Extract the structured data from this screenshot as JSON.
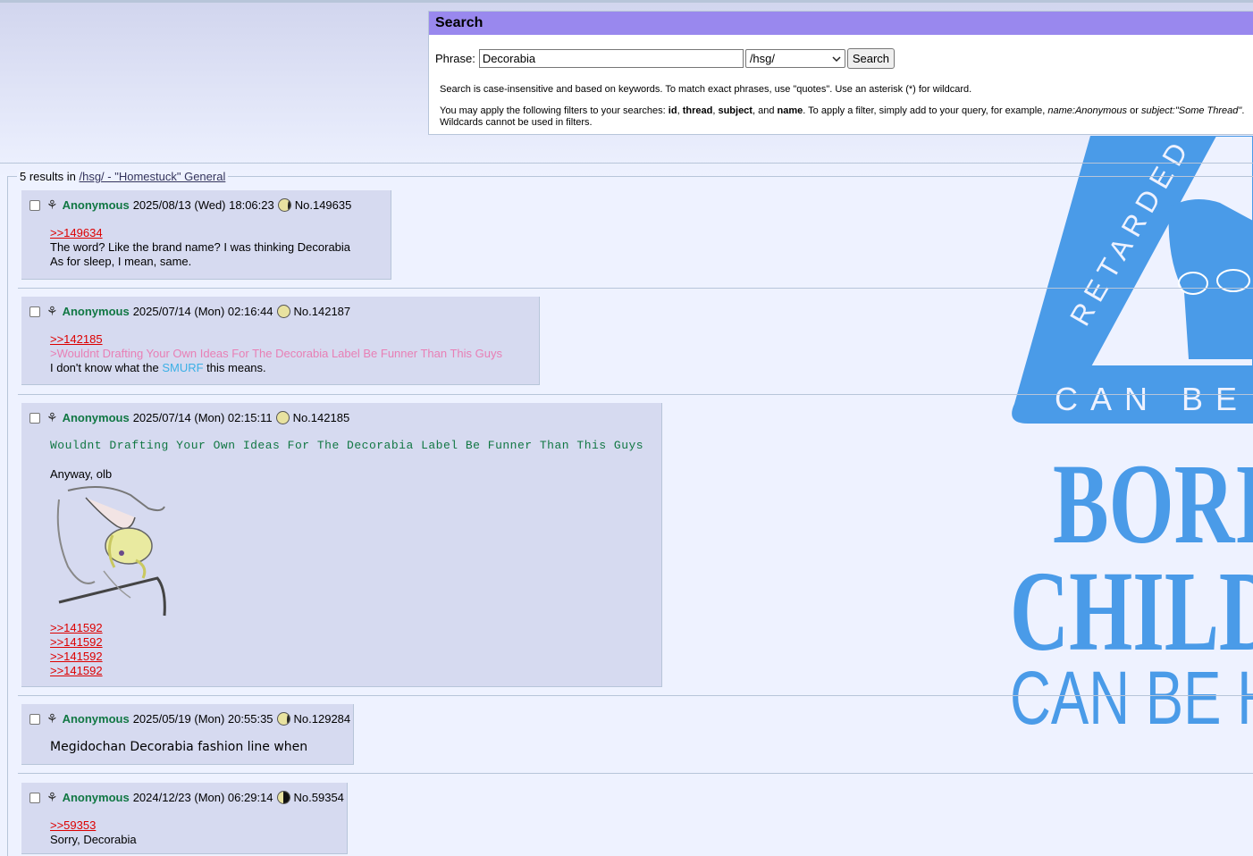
{
  "search": {
    "title": "Search",
    "phrase_label": "Phrase:",
    "phrase_value": "Decorabia",
    "board_selected": "/hsg/",
    "button_label": "Search",
    "help_1": "Search is case-insensitive and based on keywords. To match exact phrases, use \"quotes\". Use an asterisk (*) for wildcard.",
    "help_2_a": "You may apply the following filters to your searches: ",
    "filter_id": "id",
    "filter_thread": "thread",
    "filter_subject": "subject",
    "help_2_and": ", and ",
    "filter_name": "name",
    "help_2_b": ". To apply a filter, simply add to your query, for example, ",
    "example_1": "name:Anonymous",
    "help_2_or": " or ",
    "example_2": "subject:\"Some Thread\"",
    "help_2_c": ".",
    "help_3": "Wildcards cannot be used in filters."
  },
  "results": {
    "count_text": "5 results in ",
    "board_link": "/hsg/ - \"Homestuck\" General"
  },
  "banner": {
    "triangle_text": "RETARDED",
    "line1": "CAN BE H",
    "line2": "BORI",
    "line3": "CHILD",
    "line4": "CAN BE H"
  },
  "posts": [
    {
      "name": "Anonymous",
      "date": "2025/08/13 (Wed) 18:06:23",
      "no": "No.149635",
      "quote": ">>149634",
      "line1": "The word? Like the brand name? I was thinking Decorabia",
      "line2": "As for sleep, I mean, same."
    },
    {
      "name": "Anonymous",
      "date": "2025/07/14 (Mon) 02:16:44",
      "no": "No.142187",
      "quote": ">>142185",
      "green": ">Wouldnt Drafting Your Own Ideas For The Decorabia Label Be Funner Than This Guys",
      "text_a": "I don't know what the ",
      "text_b": "SMURF",
      "text_c": " this means."
    },
    {
      "name": "Anonymous",
      "date": "2025/07/14 (Mon) 02:15:11",
      "no": "No.142185",
      "subject": "Wouldnt Drafting Your Own Ideas For The Decorabia Label Be Funner Than This Guys",
      "text": "Anyway, olb",
      "quotes": [
        ">>141592",
        ">>141592",
        ">>141592",
        ">>141592"
      ]
    },
    {
      "name": "Anonymous",
      "date": "2025/05/19 (Mon) 20:55:35",
      "no": "No.129284",
      "text": "Megidochan Decorabia fashion line when"
    },
    {
      "name": "Anonymous",
      "date": "2024/12/23 (Mon) 06:29:14",
      "no": "No.59354",
      "quote": ">>59353",
      "text": "Sorry, Decorabia"
    }
  ],
  "colors": {
    "page_bg": "#eef2ff",
    "post_bg": "#d6daf0",
    "name": "#117743",
    "quotelink": "#dd0000",
    "greentext": "#e87fb5",
    "search_header": "#9988ee",
    "banner_blue": "#4a9be8"
  }
}
